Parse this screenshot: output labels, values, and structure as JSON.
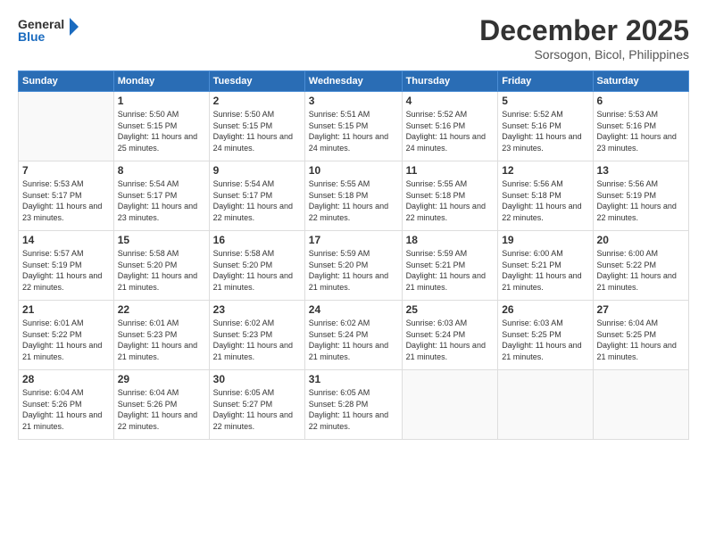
{
  "logo": {
    "general": "General",
    "blue": "Blue"
  },
  "title": "December 2025",
  "subtitle": "Sorsogon, Bicol, Philippines",
  "weekdays": [
    "Sunday",
    "Monday",
    "Tuesday",
    "Wednesday",
    "Thursday",
    "Friday",
    "Saturday"
  ],
  "weeks": [
    [
      {
        "day": null
      },
      {
        "day": "1",
        "rise": "5:50 AM",
        "set": "5:15 PM",
        "daylight": "11 hours and 25 minutes."
      },
      {
        "day": "2",
        "rise": "5:50 AM",
        "set": "5:15 PM",
        "daylight": "11 hours and 24 minutes."
      },
      {
        "day": "3",
        "rise": "5:51 AM",
        "set": "5:15 PM",
        "daylight": "11 hours and 24 minutes."
      },
      {
        "day": "4",
        "rise": "5:52 AM",
        "set": "5:16 PM",
        "daylight": "11 hours and 24 minutes."
      },
      {
        "day": "5",
        "rise": "5:52 AM",
        "set": "5:16 PM",
        "daylight": "11 hours and 23 minutes."
      },
      {
        "day": "6",
        "rise": "5:53 AM",
        "set": "5:16 PM",
        "daylight": "11 hours and 23 minutes."
      }
    ],
    [
      {
        "day": "7",
        "rise": "5:53 AM",
        "set": "5:17 PM",
        "daylight": "11 hours and 23 minutes."
      },
      {
        "day": "8",
        "rise": "5:54 AM",
        "set": "5:17 PM",
        "daylight": "11 hours and 23 minutes."
      },
      {
        "day": "9",
        "rise": "5:54 AM",
        "set": "5:17 PM",
        "daylight": "11 hours and 22 minutes."
      },
      {
        "day": "10",
        "rise": "5:55 AM",
        "set": "5:18 PM",
        "daylight": "11 hours and 22 minutes."
      },
      {
        "day": "11",
        "rise": "5:55 AM",
        "set": "5:18 PM",
        "daylight": "11 hours and 22 minutes."
      },
      {
        "day": "12",
        "rise": "5:56 AM",
        "set": "5:18 PM",
        "daylight": "11 hours and 22 minutes."
      },
      {
        "day": "13",
        "rise": "5:56 AM",
        "set": "5:19 PM",
        "daylight": "11 hours and 22 minutes."
      }
    ],
    [
      {
        "day": "14",
        "rise": "5:57 AM",
        "set": "5:19 PM",
        "daylight": "11 hours and 22 minutes."
      },
      {
        "day": "15",
        "rise": "5:58 AM",
        "set": "5:20 PM",
        "daylight": "11 hours and 21 minutes."
      },
      {
        "day": "16",
        "rise": "5:58 AM",
        "set": "5:20 PM",
        "daylight": "11 hours and 21 minutes."
      },
      {
        "day": "17",
        "rise": "5:59 AM",
        "set": "5:20 PM",
        "daylight": "11 hours and 21 minutes."
      },
      {
        "day": "18",
        "rise": "5:59 AM",
        "set": "5:21 PM",
        "daylight": "11 hours and 21 minutes."
      },
      {
        "day": "19",
        "rise": "6:00 AM",
        "set": "5:21 PM",
        "daylight": "11 hours and 21 minutes."
      },
      {
        "day": "20",
        "rise": "6:00 AM",
        "set": "5:22 PM",
        "daylight": "11 hours and 21 minutes."
      }
    ],
    [
      {
        "day": "21",
        "rise": "6:01 AM",
        "set": "5:22 PM",
        "daylight": "11 hours and 21 minutes."
      },
      {
        "day": "22",
        "rise": "6:01 AM",
        "set": "5:23 PM",
        "daylight": "11 hours and 21 minutes."
      },
      {
        "day": "23",
        "rise": "6:02 AM",
        "set": "5:23 PM",
        "daylight": "11 hours and 21 minutes."
      },
      {
        "day": "24",
        "rise": "6:02 AM",
        "set": "5:24 PM",
        "daylight": "11 hours and 21 minutes."
      },
      {
        "day": "25",
        "rise": "6:03 AM",
        "set": "5:24 PM",
        "daylight": "11 hours and 21 minutes."
      },
      {
        "day": "26",
        "rise": "6:03 AM",
        "set": "5:25 PM",
        "daylight": "11 hours and 21 minutes."
      },
      {
        "day": "27",
        "rise": "6:04 AM",
        "set": "5:25 PM",
        "daylight": "11 hours and 21 minutes."
      }
    ],
    [
      {
        "day": "28",
        "rise": "6:04 AM",
        "set": "5:26 PM",
        "daylight": "11 hours and 21 minutes."
      },
      {
        "day": "29",
        "rise": "6:04 AM",
        "set": "5:26 PM",
        "daylight": "11 hours and 22 minutes."
      },
      {
        "day": "30",
        "rise": "6:05 AM",
        "set": "5:27 PM",
        "daylight": "11 hours and 22 minutes."
      },
      {
        "day": "31",
        "rise": "6:05 AM",
        "set": "5:28 PM",
        "daylight": "11 hours and 22 minutes."
      },
      {
        "day": null
      },
      {
        "day": null
      },
      {
        "day": null
      }
    ]
  ]
}
